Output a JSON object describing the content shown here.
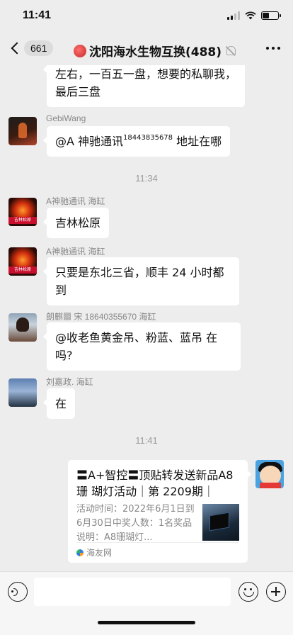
{
  "status_bar": {
    "time": "11:41"
  },
  "nav": {
    "unread_count": "661",
    "title": "沈阳海水生物互换(488)"
  },
  "messages": [
    {
      "text": "左右，一百五一盘，想要的私聊我，最后三盘"
    },
    {
      "sender": "GebiWang",
      "text_main": "@A 神驰通讯",
      "text_sup": "18443835678",
      "text_tail": " 地址在哪"
    },
    {
      "time": "11:34"
    },
    {
      "sender": "A神驰通讯 海缸",
      "text": "吉林松原"
    },
    {
      "sender": "A神驰通讯 海缸",
      "text": "只要是东北三省，顺丰 24 小时都到"
    },
    {
      "sender": "朗麒▩ 宋 18640355670 海缸",
      "text": "@收老鱼黄金吊、粉蓝、蓝吊  在吗?"
    },
    {
      "sender": "刘嘉政. 海缸",
      "text": "在"
    },
    {
      "time": "11:41"
    }
  ],
  "shared_card": {
    "title": "〓A+智控〓顶贴转发送新品A8珊 瑚灯活动｜第 2209期｜",
    "description": "活动时间：2022年6月1日到6月30日中奖人数：1名奖品说明：A8珊瑚灯...",
    "source": "海友网"
  },
  "avatar_caption": "吉林松原",
  "input": {
    "placeholder": ""
  }
}
